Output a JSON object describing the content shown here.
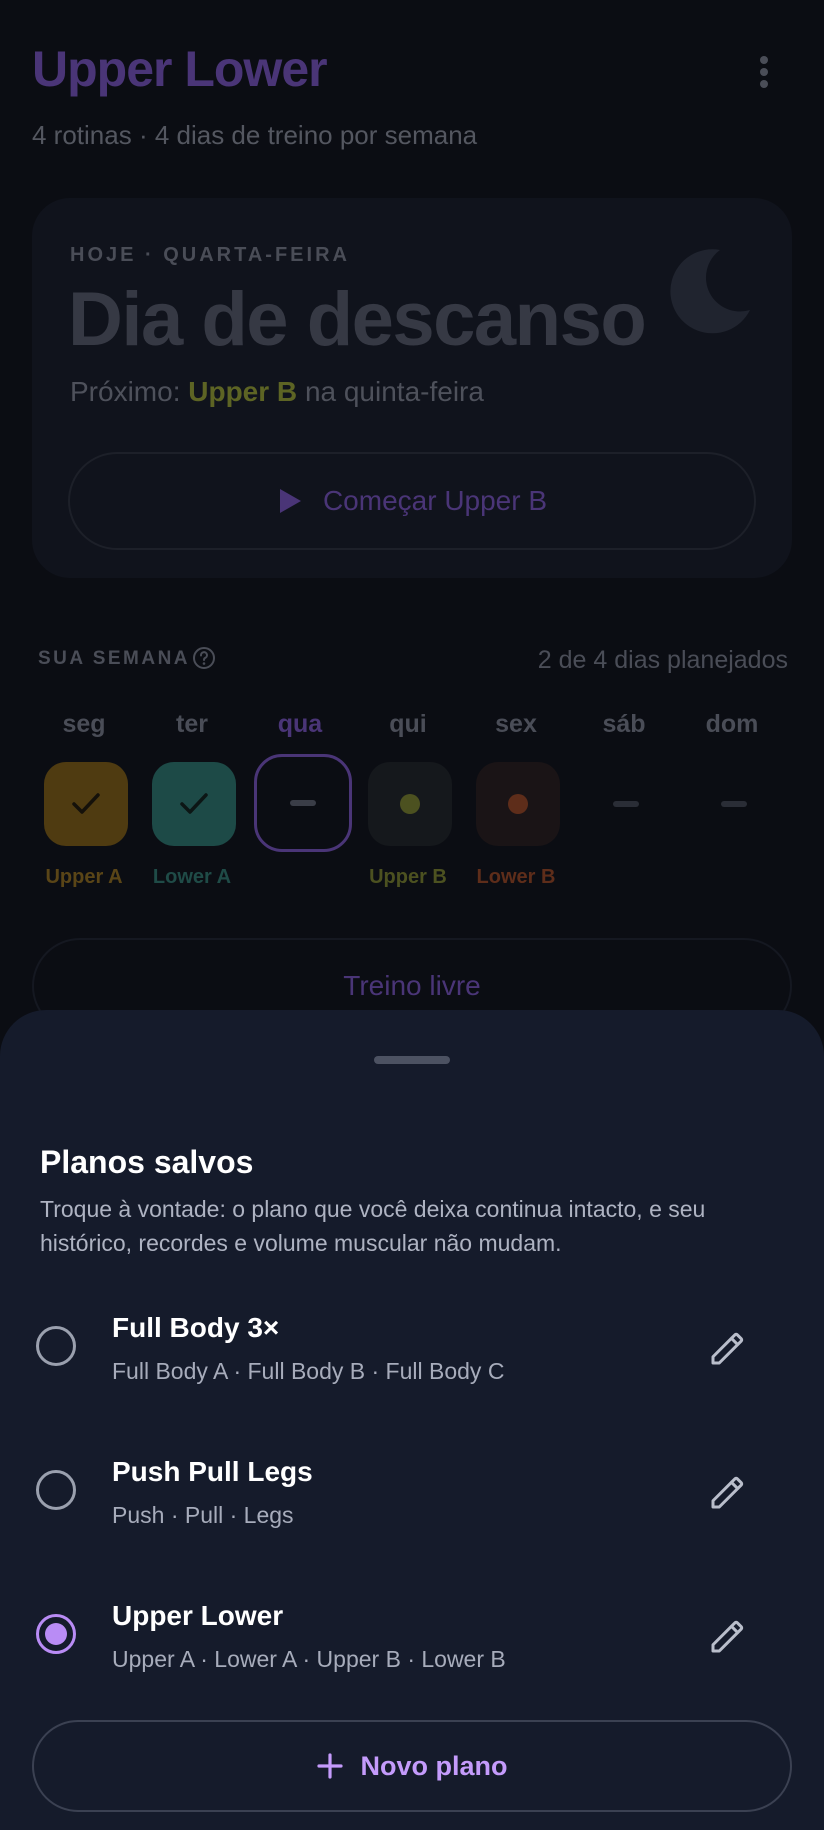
{
  "header": {
    "title": "Upper Lower",
    "subtitle": "4 rotinas · 4 dias de treino por semana",
    "menu_icon": "more-vert-icon"
  },
  "today": {
    "eyebrow": "HOJE · QUARTA-FEIRA",
    "title": "Dia de descanso",
    "next_prefix": "Próximo:",
    "next_routine": "Upper B",
    "next_suffix": "na quinta-feira",
    "start_label": "Começar Upper B",
    "icon": "moon-icon"
  },
  "week": {
    "label": "SUA SEMANA",
    "count": "2 de 4 dias planejados",
    "days": [
      {
        "name": "seg",
        "routine": "Upper A",
        "status": "done",
        "color": "#c78a1e"
      },
      {
        "name": "ter",
        "routine": "Lower A",
        "status": "done",
        "color": "#3fae9d"
      },
      {
        "name": "qua",
        "routine": "",
        "status": "today",
        "color": "#7c5cc4"
      },
      {
        "name": "qui",
        "routine": "Upper B",
        "status": "planned",
        "color": "#a8b13c"
      },
      {
        "name": "sex",
        "routine": "Lower B",
        "status": "planned",
        "color": "#d2663a"
      },
      {
        "name": "sáb",
        "routine": "",
        "status": "rest",
        "color": ""
      },
      {
        "name": "dom",
        "routine": "",
        "status": "rest",
        "color": ""
      }
    ]
  },
  "free_workout_label": "Treino livre",
  "sheet": {
    "title": "Planos salvos",
    "description": "Troque à vontade: o plano que você deixa continua intacto, e seu histórico, recordes e volume muscular não mudam.",
    "plans": [
      {
        "name": "Full Body 3×",
        "routines": "Full Body A · Full Body B · Full Body C",
        "selected": false
      },
      {
        "name": "Push Pull Legs",
        "routines": "Push · Pull · Legs",
        "selected": false
      },
      {
        "name": "Upper Lower",
        "routines": "Upper A · Lower A · Upper B · Lower B",
        "selected": true
      }
    ],
    "new_plan_label": "Novo plano",
    "edit_icon": "pencil-icon",
    "accent": "#b98cf5"
  }
}
